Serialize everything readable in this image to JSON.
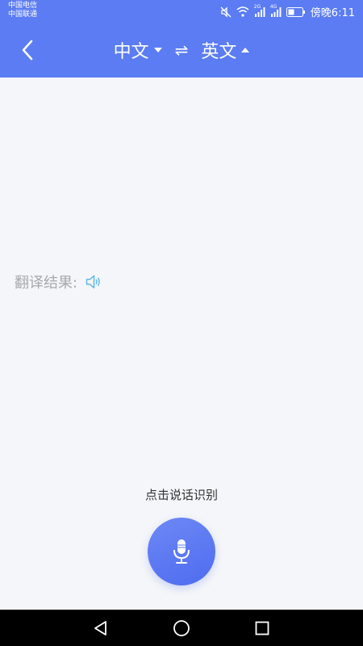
{
  "status_bar": {
    "carrier_1": "中国电信",
    "carrier_2": "中国联通",
    "signal_1_label": "2G",
    "signal_2_label": "4G",
    "time": "傍晚6:11"
  },
  "header": {
    "source_language": "中文",
    "swap_symbol": "⇌",
    "target_language": "英文"
  },
  "main": {
    "result_label": "翻译结果:",
    "hint": "点击说话识别"
  },
  "icons": {
    "back": "chevron-left-icon",
    "source_dropdown": "caret-down-icon",
    "target_dropdown": "caret-up-icon",
    "swap": "swap-arrows-icon",
    "speaker": "speaker-icon",
    "mic": "microphone-icon"
  },
  "colors": {
    "primary": "#5b7cf2",
    "background": "#f5f6f9",
    "speaker": "#58b7e6",
    "label": "#a8a8ae"
  }
}
